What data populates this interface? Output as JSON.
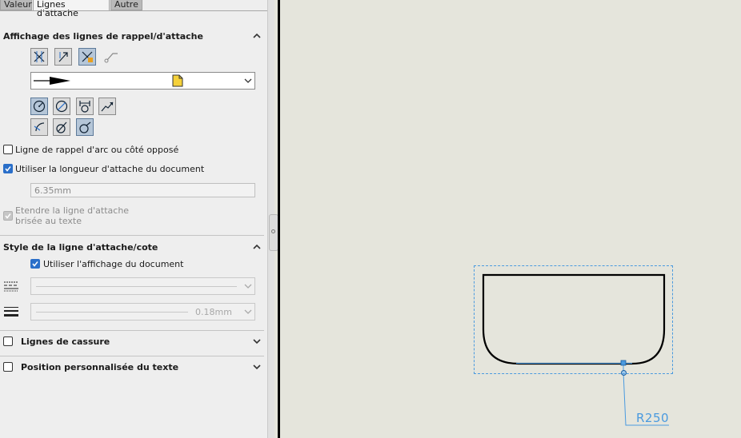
{
  "tabs": [
    {
      "label": "Valeur",
      "active": false
    },
    {
      "label": "Lignes d'attache",
      "active": true
    },
    {
      "label": "Autre",
      "active": false
    }
  ],
  "leader_display": {
    "title": "Affichage des lignes de rappel/d'attache",
    "tool_icons_row1": [
      "leader-style-1-icon",
      "leader-style-2-icon",
      "leader-style-3-icon",
      "leader-bent-icon"
    ],
    "arrow_style_icons": [
      "arrow-filled-icon",
      "file-icon"
    ],
    "tool_icons_row2": [
      "radius-dimension-icon",
      "diameter-dimension-icon",
      "linear-dimension-icon",
      "foreshortened-icon"
    ],
    "tool_icons_row3": [
      "radius-leader-icon",
      "diameter-leader-icon",
      "diameter-open-leader-icon"
    ],
    "opposite_side_label": "Ligne de rappel d'arc ou côté opposé",
    "opposite_side_checked": false,
    "use_doc_length_label": "Utiliser la longueur d'attache du document",
    "use_doc_length_checked": true,
    "leader_length_value": "6.35mm",
    "extend_broken_label_line1": "Etendre la ligne d'attache",
    "extend_broken_label_line2": "brisée au texte",
    "extend_broken_checked": true
  },
  "line_style": {
    "title": "Style de la ligne d'attache/cote",
    "use_doc_display_label": "Utiliser l'affichage du document",
    "use_doc_display_checked": true,
    "line_thickness_value": "0.18mm"
  },
  "break_lines": {
    "title": "Lignes de cassure",
    "checked": false
  },
  "custom_text_position": {
    "title": "Position personnalisée du texte",
    "checked": false
  },
  "drawing": {
    "dimension_label": "R250"
  },
  "colors": {
    "accent": "#2a6fc9",
    "dimension": "#4a9adf",
    "panel_bg": "#eeeeee",
    "canvas_bg": "#e5e5dc"
  }
}
